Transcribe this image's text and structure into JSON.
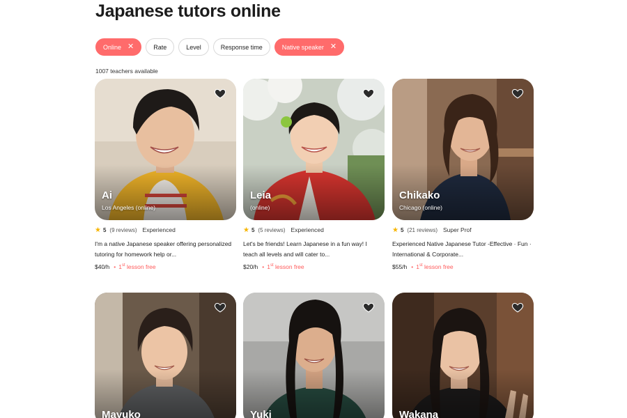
{
  "page": {
    "title": "Japanese tutors online",
    "teacher_count": "1007 teachers available"
  },
  "filters": [
    {
      "label": "Online",
      "active": true
    },
    {
      "label": "Rate",
      "active": false
    },
    {
      "label": "Level",
      "active": false
    },
    {
      "label": "Response time",
      "active": false
    },
    {
      "label": "Native speaker",
      "active": true
    }
  ],
  "filter_remove_glyph": "✕",
  "colors": {
    "accent": "#ff6b6b",
    "star": "#f7b500"
  },
  "tutors": [
    {
      "name": "Ai",
      "location": "Los Angeles (online)",
      "rating": "5",
      "reviews": "(9 reviews)",
      "badge": "Experienced",
      "description": "I'm a native Japanese speaker offering personalized tutoring for homework help or...",
      "price": "$40/h",
      "lesson_prefix": "1",
      "lesson_sup": "st",
      "lesson_suffix": " lesson free"
    },
    {
      "name": "Leia",
      "location": "(online)",
      "rating": "5",
      "reviews": "(5 reviews)",
      "badge": "Experienced",
      "description": "Let's be friends! Learn Japanese in a fun way! I teach all levels and will cater to...",
      "price": "$20/h",
      "lesson_prefix": "1",
      "lesson_sup": "st",
      "lesson_suffix": " lesson free"
    },
    {
      "name": "Chikako",
      "location": "Chicago (online)",
      "rating": "5",
      "reviews": "(21 reviews)",
      "badge": "Super Prof",
      "description": "Experienced Native Japanese Tutor -Effective · Fun · International & Corporate...",
      "price": "$55/h",
      "lesson_prefix": "1",
      "lesson_sup": "st",
      "lesson_suffix": " lesson free"
    },
    {
      "name": "Mayuko"
    },
    {
      "name": "Yuki"
    },
    {
      "name": "Wakana"
    }
  ]
}
